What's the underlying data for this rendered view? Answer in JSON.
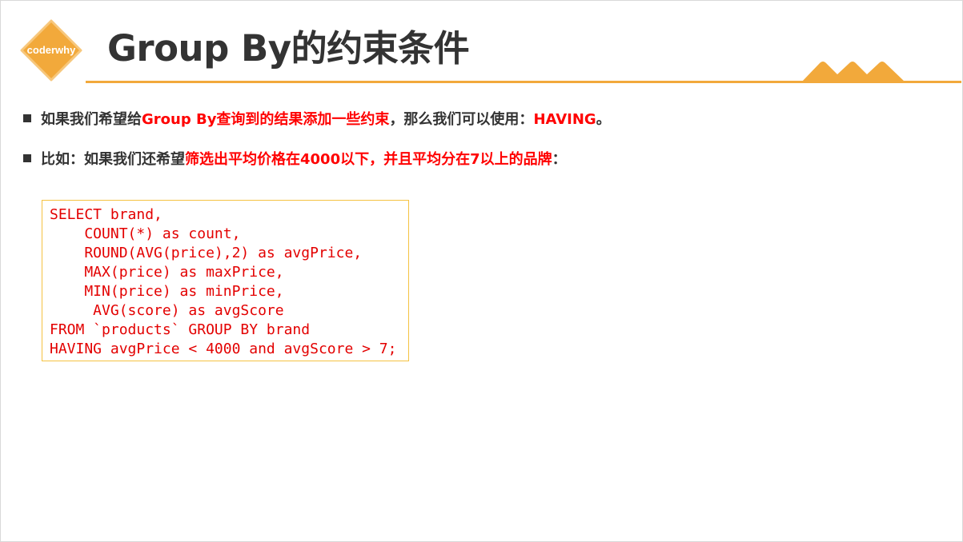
{
  "logo": {
    "text": "coderwhy",
    "color": "#f2a93b"
  },
  "title": "Group By的约束条件",
  "bullets": [
    {
      "before": "如果我们希望给",
      "highlight": "Group By查询到的结果添加一些约束",
      "middle": "，那么我们可以使用：",
      "keyword": "HAVING",
      "after": "。"
    },
    {
      "before": "比如：如果我们还希望",
      "highlight": "筛选出平均价格在4000以下，并且平均分在7以上的品牌",
      "after": "："
    }
  ],
  "code": {
    "lines": [
      "SELECT brand,",
      "    COUNT(*) as count,",
      "    ROUND(AVG(price),2) as avgPrice,",
      "    MAX(price) as maxPrice,",
      "    MIN(price) as minPrice,",
      "     AVG(score) as avgScore",
      "FROM `products` GROUP BY brand",
      "HAVING avgPrice < 4000 and avgScore > 7;"
    ]
  },
  "colors": {
    "accent": "#f2a93b",
    "highlight": "#ff0000",
    "code_text": "#e30000",
    "code_border": "#f5c242",
    "body_text": "#333333"
  }
}
